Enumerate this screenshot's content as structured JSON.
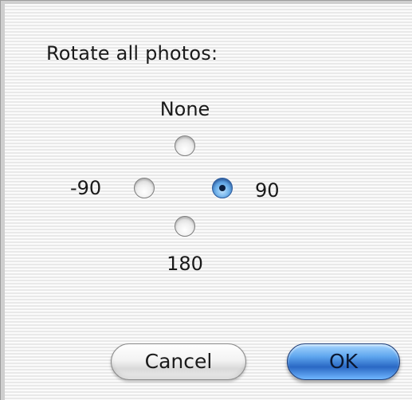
{
  "dialog": {
    "title": "Rotate all photos:",
    "options": [
      {
        "label": "None",
        "value": "none",
        "selected": false
      },
      {
        "label": "-90",
        "value": "-90",
        "selected": false
      },
      {
        "label": "90",
        "value": "90",
        "selected": true
      },
      {
        "label": "180",
        "value": "180",
        "selected": false
      }
    ],
    "buttons": {
      "cancel_label": "Cancel",
      "ok_label": "OK"
    }
  }
}
